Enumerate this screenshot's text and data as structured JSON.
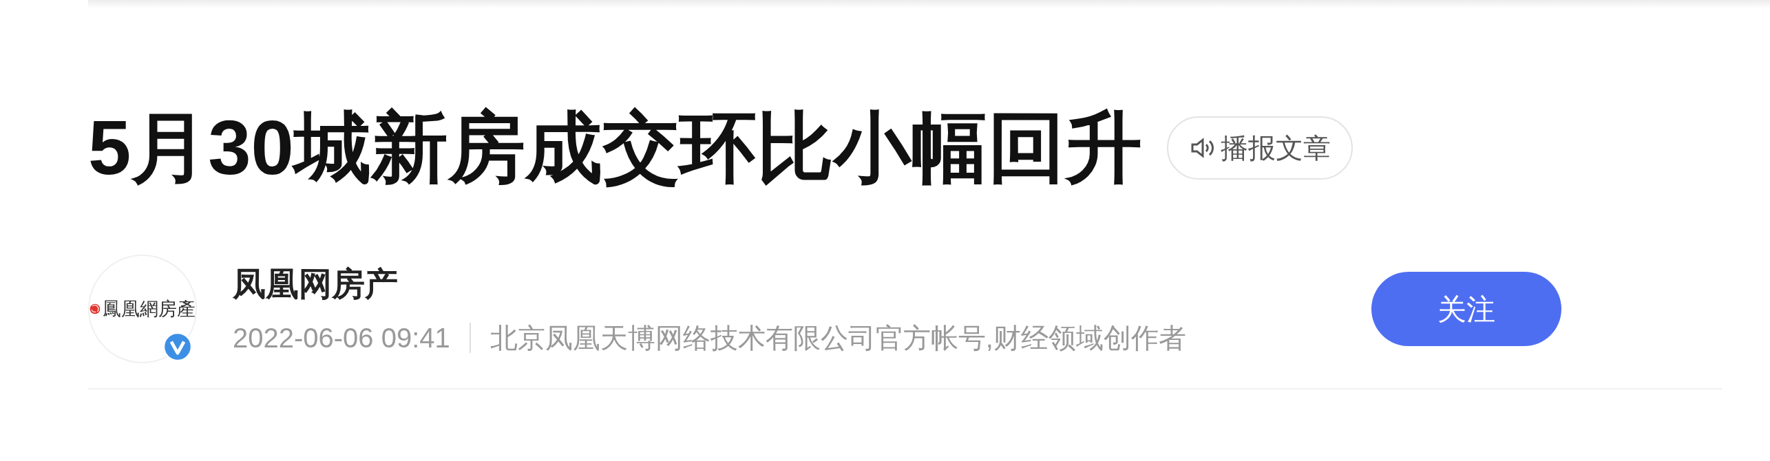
{
  "article": {
    "title": "5月30城新房成交环比小幅回升",
    "listen_button": "播报文章"
  },
  "author": {
    "logo_text": "鳳凰網房產",
    "verified": true,
    "name": "凤凰网房产",
    "time": "2022-06-06 09:41",
    "description": "北京凤凰天博网络技术有限公司官方帐号,财经领域创作者",
    "follow_button": "关注"
  }
}
